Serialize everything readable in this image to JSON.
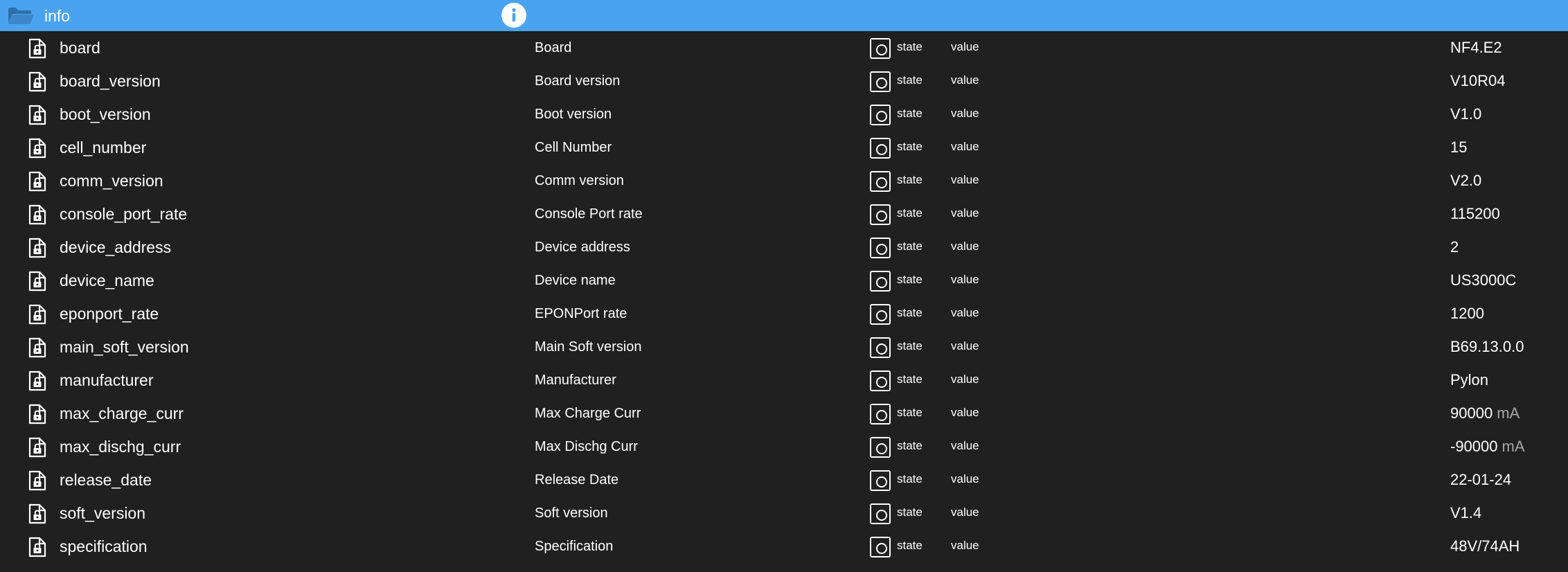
{
  "header": {
    "title": "info"
  },
  "rows": [
    {
      "id": "board",
      "name": "Board",
      "role": "state",
      "type": "value",
      "value": "NF4.E2",
      "unit": ""
    },
    {
      "id": "board_version",
      "name": "Board version",
      "role": "state",
      "type": "value",
      "value": "V10R04",
      "unit": ""
    },
    {
      "id": "boot_version",
      "name": "Boot version",
      "role": "state",
      "type": "value",
      "value": "V1.0",
      "unit": ""
    },
    {
      "id": "cell_number",
      "name": "Cell Number",
      "role": "state",
      "type": "value",
      "value": "15",
      "unit": ""
    },
    {
      "id": "comm_version",
      "name": "Comm version",
      "role": "state",
      "type": "value",
      "value": "V2.0",
      "unit": ""
    },
    {
      "id": "console_port_rate",
      "name": "Console Port rate",
      "role": "state",
      "type": "value",
      "value": "115200",
      "unit": ""
    },
    {
      "id": "device_address",
      "name": "Device address",
      "role": "state",
      "type": "value",
      "value": "2",
      "unit": ""
    },
    {
      "id": "device_name",
      "name": "Device name",
      "role": "state",
      "type": "value",
      "value": "US3000C",
      "unit": ""
    },
    {
      "id": "eponport_rate",
      "name": "EPONPort rate",
      "role": "state",
      "type": "value",
      "value": "1200",
      "unit": ""
    },
    {
      "id": "main_soft_version",
      "name": "Main Soft version",
      "role": "state",
      "type": "value",
      "value": "B69.13.0.0",
      "unit": ""
    },
    {
      "id": "manufacturer",
      "name": "Manufacturer",
      "role": "state",
      "type": "value",
      "value": "Pylon",
      "unit": ""
    },
    {
      "id": "max_charge_curr",
      "name": "Max Charge Curr",
      "role": "state",
      "type": "value",
      "value": "90000",
      "unit": "mA"
    },
    {
      "id": "max_dischg_curr",
      "name": "Max Dischg Curr",
      "role": "state",
      "type": "value",
      "value": "-90000",
      "unit": "mA"
    },
    {
      "id": "release_date",
      "name": "Release Date",
      "role": "state",
      "type": "value",
      "value": "22-01-24",
      "unit": ""
    },
    {
      "id": "soft_version",
      "name": "Soft version",
      "role": "state",
      "type": "value",
      "value": "V1.4",
      "unit": ""
    },
    {
      "id": "specification",
      "name": "Specification",
      "role": "state",
      "type": "value",
      "value": "48V/74AH",
      "unit": ""
    }
  ],
  "icons": {
    "header_folder": "folder-open-icon",
    "header_info": "info-icon",
    "row_object": "file-lock-icon",
    "row_role": "state-role-icon"
  },
  "colors": {
    "header_bg": "#4aa3f0",
    "page_bg": "#202020",
    "text": "#ffffff",
    "unit": "#a8a8a8"
  }
}
